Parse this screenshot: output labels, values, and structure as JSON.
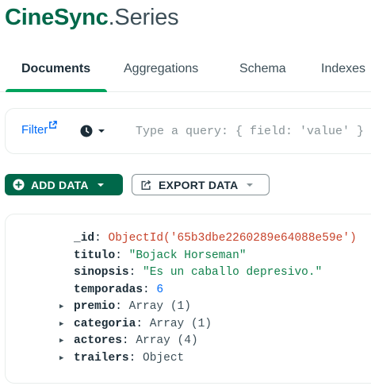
{
  "header": {
    "database": "CineSync",
    "separator": ".",
    "collection": "Series"
  },
  "tabs": [
    {
      "label": "Documents",
      "active": true
    },
    {
      "label": "Aggregations",
      "active": false
    },
    {
      "label": "Schema",
      "active": false
    },
    {
      "label": "Indexes",
      "active": false
    }
  ],
  "filter": {
    "label": "Filter",
    "link_icon": "external-link-icon",
    "history_icon": "clock-icon",
    "query_placeholder": "Type a query: { field: 'value' }",
    "query_value": ""
  },
  "toolbar": {
    "add_label": "ADD DATA",
    "add_icon": "plus-circle-icon",
    "export_label": "EXPORT DATA",
    "export_icon": "export-icon"
  },
  "document": {
    "fields": [
      {
        "key": "_id",
        "value": "ObjectId('65b3dbe2260289e64088e59e')",
        "kind": "oid",
        "expandable": false
      },
      {
        "key": "titulo",
        "value": "\"Bojack Horseman\"",
        "kind": "str",
        "expandable": false
      },
      {
        "key": "sinopsis",
        "value": "\"Es un caballo depresivo.\"",
        "kind": "str",
        "expandable": false
      },
      {
        "key": "temporadas",
        "value": "6",
        "kind": "num",
        "expandable": false
      },
      {
        "key": "premio",
        "value": "Array (1)",
        "kind": "type",
        "expandable": true
      },
      {
        "key": "categoria",
        "value": "Array (1)",
        "kind": "type",
        "expandable": true
      },
      {
        "key": "actores",
        "value": "Array (4)",
        "kind": "type",
        "expandable": true
      },
      {
        "key": "trailers",
        "value": "Object",
        "kind": "type",
        "expandable": true
      }
    ]
  },
  "colors": {
    "brand_green": "#00684a",
    "accent_green": "#00a35c",
    "link_blue": "#016bf8",
    "oid_red": "#c7432b",
    "string_green": "#12824d"
  }
}
